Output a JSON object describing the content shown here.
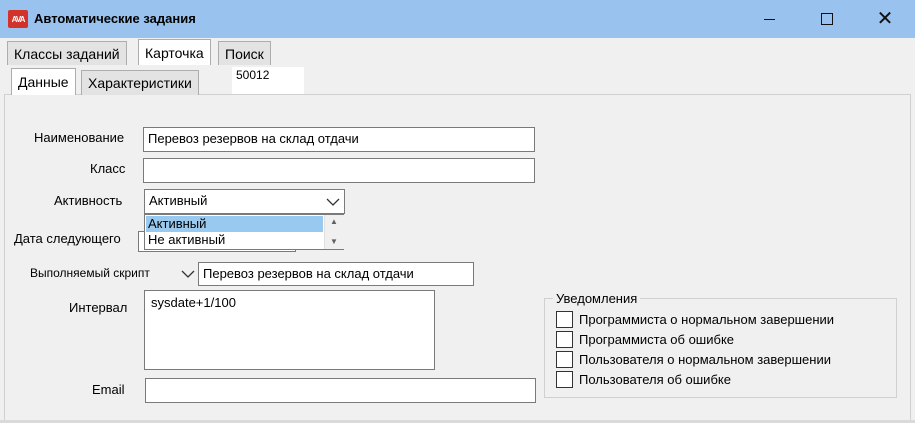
{
  "window": {
    "title": "Автоматические задания",
    "icon_text": "AVA",
    "close_glyph": "✕"
  },
  "tabs": {
    "main": [
      {
        "label": "Классы заданий"
      },
      {
        "label": "Карточка"
      },
      {
        "label": "Поиск"
      }
    ],
    "sub": [
      {
        "label": "Данные"
      },
      {
        "label": "Характеристики"
      }
    ],
    "record_id": "50012"
  },
  "form": {
    "name_label": "Наименование",
    "name_value": "Перевоз резервов на склад отдачи",
    "class_label": "Класс",
    "class_value": "",
    "activity_label": "Активность",
    "activity_value": "Активный",
    "activity_options": [
      "Активный",
      "Не активный"
    ],
    "next_date_label": "Дата следующего",
    "script_label": "Выполняемый скрипт",
    "script_value": "Перевоз резервов на склад отдачи",
    "interval_label": "Интервал",
    "interval_value": "sysdate+1/100",
    "email_label": "Email",
    "email_value": ""
  },
  "notifications": {
    "title": "Уведомления",
    "items": [
      {
        "label": "Программиста о нормальном завершении",
        "checked": false
      },
      {
        "label": "Программиста об ошибке",
        "checked": false
      },
      {
        "label": "Пользователя о нормальном завершении",
        "checked": false
      },
      {
        "label": "Пользователя об ошибке",
        "checked": false
      }
    ]
  },
  "colors": {
    "titlebar": "#99c2ee",
    "selection": "#99c9ef",
    "app_icon": "#d1322a"
  }
}
